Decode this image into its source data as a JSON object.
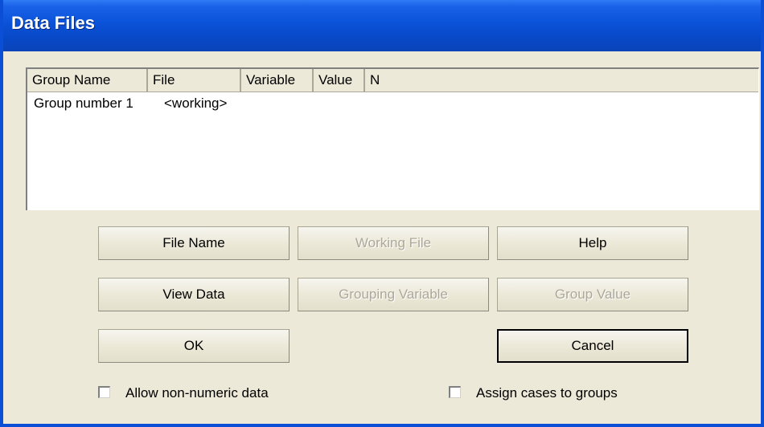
{
  "window": {
    "title": "Data Files"
  },
  "list": {
    "columns": [
      "Group Name",
      "File",
      "Variable",
      "Value",
      "N"
    ],
    "rows": [
      {
        "group_name": "Group number 1",
        "file": "<working>",
        "variable": "",
        "value": "",
        "n": ""
      }
    ]
  },
  "buttons": {
    "file_name": "File Name",
    "working_file": "Working File",
    "help": "Help",
    "view_data": "View Data",
    "grouping_variable": "Grouping Variable",
    "group_value": "Group Value",
    "ok": "OK",
    "cancel": "Cancel"
  },
  "checkboxes": {
    "allow_non_numeric": {
      "label": "Allow non-numeric data",
      "checked": false
    },
    "assign_cases": {
      "label": "Assign cases to groups",
      "checked": false
    }
  },
  "colors": {
    "titlebar": "#0a52d8",
    "dialog_bg": "#ece9d8",
    "disabled_text": "#aca899"
  }
}
